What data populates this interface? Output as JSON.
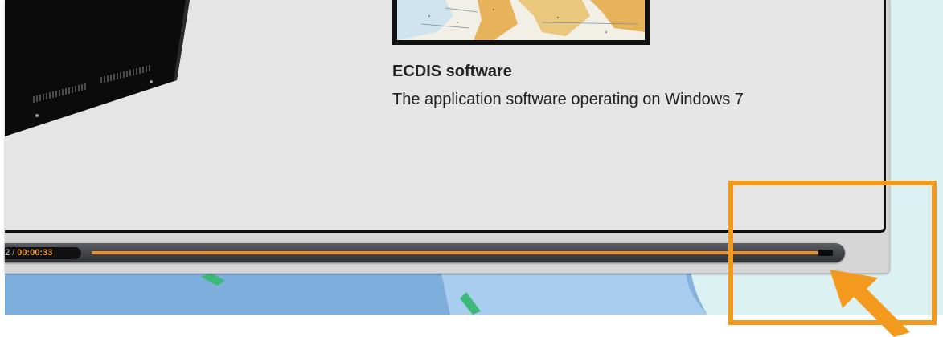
{
  "software": {
    "title": "ECDIS software",
    "description": "The application software operating on Windows 7"
  },
  "player": {
    "elapsed": "2",
    "separator": " / ",
    "duration": "00:00:33",
    "progress_fraction": 0.98
  },
  "colors": {
    "accent": "#f39a1e",
    "panel": "#e5e5e5",
    "sea": "#8fb8e0",
    "land": "#3cb878"
  },
  "icons": {
    "pointer": "pointer-arrow-icon"
  }
}
